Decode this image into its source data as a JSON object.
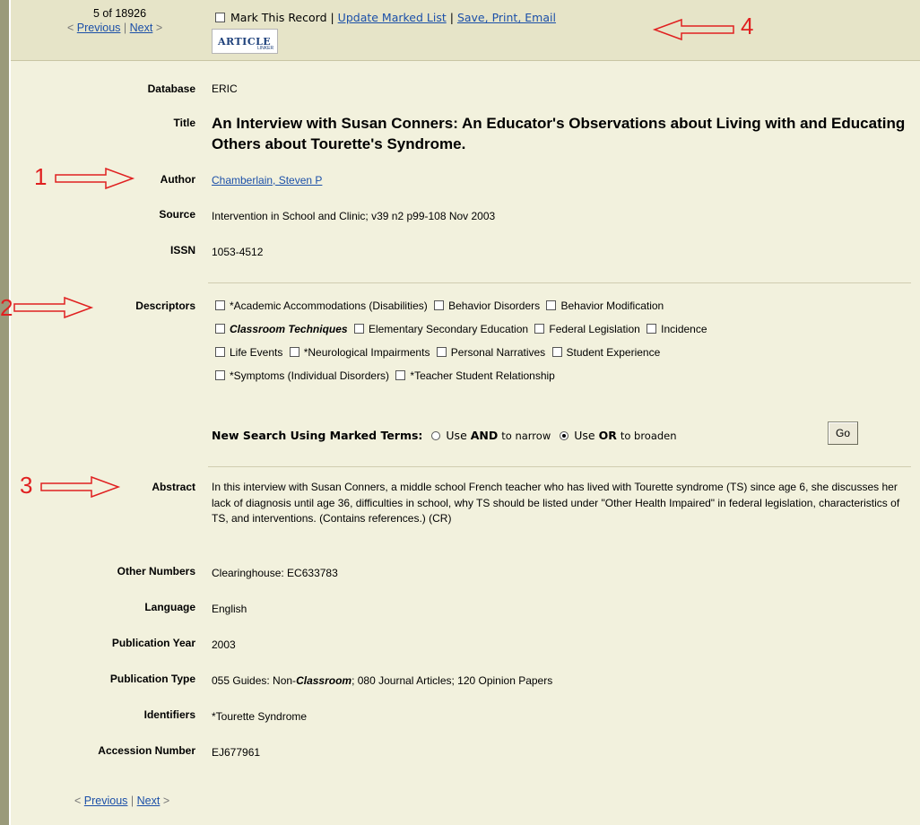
{
  "nav": {
    "counter": "5 of 18926",
    "prev_left": "<",
    "previous": "Previous",
    "separator": "|",
    "next": "Next",
    "next_right": ">"
  },
  "toolbar": {
    "mark_record": "Mark This Record |",
    "update_marked": "Update Marked List",
    "sep": "|",
    "save_print": "Save, Print, Email",
    "logo_text": "ARTICLE",
    "logo_sub": "LINKER"
  },
  "record": {
    "database_label": "Database",
    "database": "ERIC",
    "title_label": "Title",
    "title": "An Interview with Susan Conners: An Educator's Observations about Living with and Educating Others about Tourette's Syndrome.",
    "author_label": "Author",
    "author": "Chamberlain, Steven P",
    "source_label": "Source",
    "source": "Intervention in School and Clinic; v39 n2 p99-108 Nov 2003",
    "issn_label": "ISSN",
    "issn": "1053-4512",
    "descriptors_label": "Descriptors",
    "descriptors": [
      "*Academic Accommodations (Disabilities)",
      "Behavior Disorders",
      "Behavior Modification",
      "Classroom Techniques",
      "Elementary Secondary Education",
      "Federal Legislation",
      "Incidence",
      "Life Events",
      "*Neurological Impairments",
      "Personal Narratives",
      "Student Experience",
      "*Symptoms (Individual Disorders)",
      "*Teacher Student Relationship"
    ],
    "abstract_label": "Abstract",
    "abstract": "In this interview with Susan Conners, a middle school French teacher who has lived with Tourette syndrome (TS) since age 6, she discusses her lack of diagnosis until age 36, difficulties in school, why TS should be listed under \"Other Health Impaired\" in federal legislation, characteristics of TS, and interventions. (Contains references.) (CR)",
    "other_numbers_label": "Other Numbers",
    "other_numbers": "Clearinghouse: EC633783",
    "language_label": "Language",
    "language": "English",
    "pub_year_label": "Publication Year",
    "pub_year": "2003",
    "pub_type_label": "Publication Type",
    "pub_type_pre": "055 Guides: Non-",
    "pub_type_bold": "Classroom",
    "pub_type_post": "; 080 Journal Articles; 120 Opinion Papers",
    "identifiers_label": "Identifiers",
    "identifiers": "*Tourette Syndrome",
    "accession_label": "Accession Number",
    "accession": "EJ677961"
  },
  "new_search": {
    "label": "New Search Using Marked Terms:",
    "and_pre": "Use",
    "and_word": "AND",
    "and_post": "to narrow",
    "or_pre": "Use",
    "or_word": "OR",
    "or_post": "to broaden",
    "go": "Go"
  },
  "annotations": [
    "1",
    "2",
    "3",
    "4"
  ]
}
